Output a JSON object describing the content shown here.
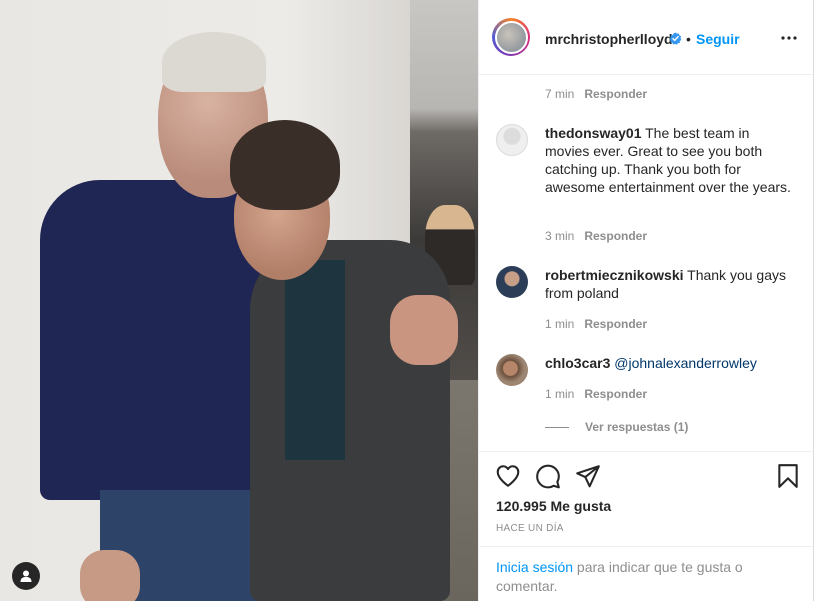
{
  "post": {
    "author": "mrchristopherlloyd",
    "separator": "•",
    "follow_label": "Seguir",
    "icons": {
      "verified": "verified-badge-icon",
      "more": "more-options-icon"
    }
  },
  "comments": [
    {
      "username": "",
      "text": "",
      "time": "7 min",
      "reply_label": "Responder"
    },
    {
      "username": "thedonsway01",
      "text": "The best team in movies ever. Great to see you both catching up. Thank you both for awesome entertainment over the years.",
      "time": "3 min",
      "reply_label": "Responder"
    },
    {
      "username": "robertmiecznikowski",
      "text": "Thank you gays from poland",
      "time": "1 min",
      "reply_label": "Responder"
    },
    {
      "username": "chlo3car3",
      "text": "@johnalexanderrowley",
      "time": "1 min",
      "reply_label": "Responder"
    }
  ],
  "view_replies": "Ver respuestas (1)",
  "actions": {
    "likes": "120.995 Me gusta",
    "time_ago": "HACE UN DÍA",
    "icons": [
      "heart-icon",
      "comment-icon",
      "share-icon",
      "bookmark-icon"
    ]
  },
  "login": {
    "link": "Inicia sesión",
    "text": " para indicar que te gusta o comentar."
  },
  "colors": {
    "link_blue": "#0095f6",
    "text": "#262626",
    "muted": "#8e8e8e"
  }
}
